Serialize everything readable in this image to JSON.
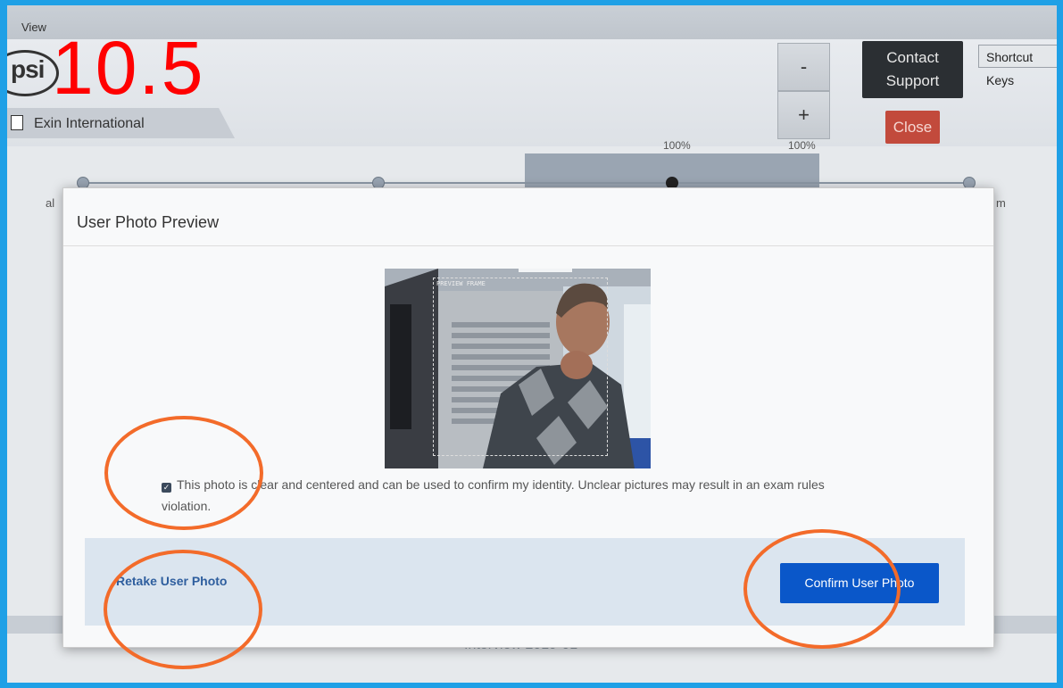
{
  "menu": {
    "view_label": "View"
  },
  "header": {
    "logo_text": "psi",
    "big_number": "10.5",
    "tab_label": "Exin International",
    "zoom_out_label": "-",
    "zoom_in_label": "+",
    "zoom_readout": "100%",
    "zoom_readout_right": "100%",
    "contact_support_label": "Contact Support",
    "close_label": "Close",
    "shortcut_keys_label": "Shortcut Keys"
  },
  "background": {
    "left_text": "al",
    "right_text": "m",
    "footer_text": "Interview 2019-01"
  },
  "modal": {
    "title": "User Photo Preview",
    "preview_frame_label": "PREVIEW FRAME",
    "confirm_checkbox_checked": true,
    "confirm_text": "This photo is clear and centered and can be used to confirm my identity. Unclear pictures may result in an exam rules violation.",
    "retake_label": "Retake User Photo",
    "confirm_label": "Confirm User Photo"
  },
  "colors": {
    "frame_border": "#1fa0e6",
    "annotation": "#f36b2a",
    "confirm_button": "#0a57c9",
    "close_button": "#c24a3c",
    "big_number": "#ff0000"
  }
}
